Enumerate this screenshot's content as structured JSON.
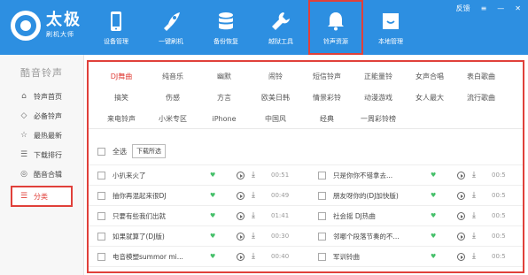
{
  "app": {
    "logo_main": "太极",
    "logo_sub": "刷机大师",
    "feedback": "反馈",
    "menu_icon": "menu-icon",
    "min_icon": "minimize-icon",
    "close_icon": "close-icon"
  },
  "nav": [
    {
      "label": "设备管理",
      "icon": "phone-icon"
    },
    {
      "label": "一键刷机",
      "icon": "rocket-icon"
    },
    {
      "label": "备份恢复",
      "icon": "database-icon"
    },
    {
      "label": "越狱工具",
      "icon": "wrench-icon"
    },
    {
      "label": "铃声资源",
      "icon": "bell-icon"
    },
    {
      "label": "本地管理",
      "icon": "box-icon"
    }
  ],
  "sidebar": {
    "title": "酷音铃声",
    "items": [
      {
        "label": "铃声首页",
        "icon": "home-icon"
      },
      {
        "label": "必备铃声",
        "icon": "diamond-icon"
      },
      {
        "label": "最热最新",
        "icon": "star-icon"
      },
      {
        "label": "下载排行",
        "icon": "list-icon"
      },
      {
        "label": "酷音合辑",
        "icon": "disc-icon"
      },
      {
        "label": "分类",
        "icon": "list-icon"
      }
    ]
  },
  "categories": [
    [
      "DJ舞曲",
      "纯音乐",
      "幽默",
      "闹铃",
      "短信铃声",
      "正能量铃",
      "女声合唱",
      "表白歌曲"
    ],
    [
      "搞笑",
      "伤感",
      "方言",
      "欧美日韩",
      "情景彩铃",
      "动漫游戏",
      "女人最大",
      "流行歌曲"
    ],
    [
      "来电铃声",
      "小米专区",
      "iPhone",
      "中国风",
      "经典",
      "一周彩铃榜"
    ]
  ],
  "toolbar": {
    "select_all": "全选",
    "download_selected": "下载所选"
  },
  "songs_left": [
    {
      "name": "小扒来火了",
      "dur": "00:51"
    },
    {
      "name": "抽你再混起来很DJ",
      "dur": "00:49"
    },
    {
      "name": "只要有些我们出就",
      "dur": "01:41"
    },
    {
      "name": "如果就算了(DJ版)",
      "dur": "00:30"
    },
    {
      "name": "电音模塑summor mi...",
      "dur": "00:40"
    }
  ],
  "songs_right": [
    {
      "name": "只是你你不错拿去...",
      "dur": "00:5"
    },
    {
      "name": "朋友呀你的(DJ加快版)",
      "dur": "00:5"
    },
    {
      "name": "社会摇 DJ热曲",
      "dur": "00:5"
    },
    {
      "name": "邻哪个段落节奏的不...",
      "dur": "00:5"
    },
    {
      "name": "军训铃曲",
      "dur": "00:5"
    }
  ],
  "colors": {
    "accent": "#2d8fe1",
    "highlight": "#e0403a"
  }
}
